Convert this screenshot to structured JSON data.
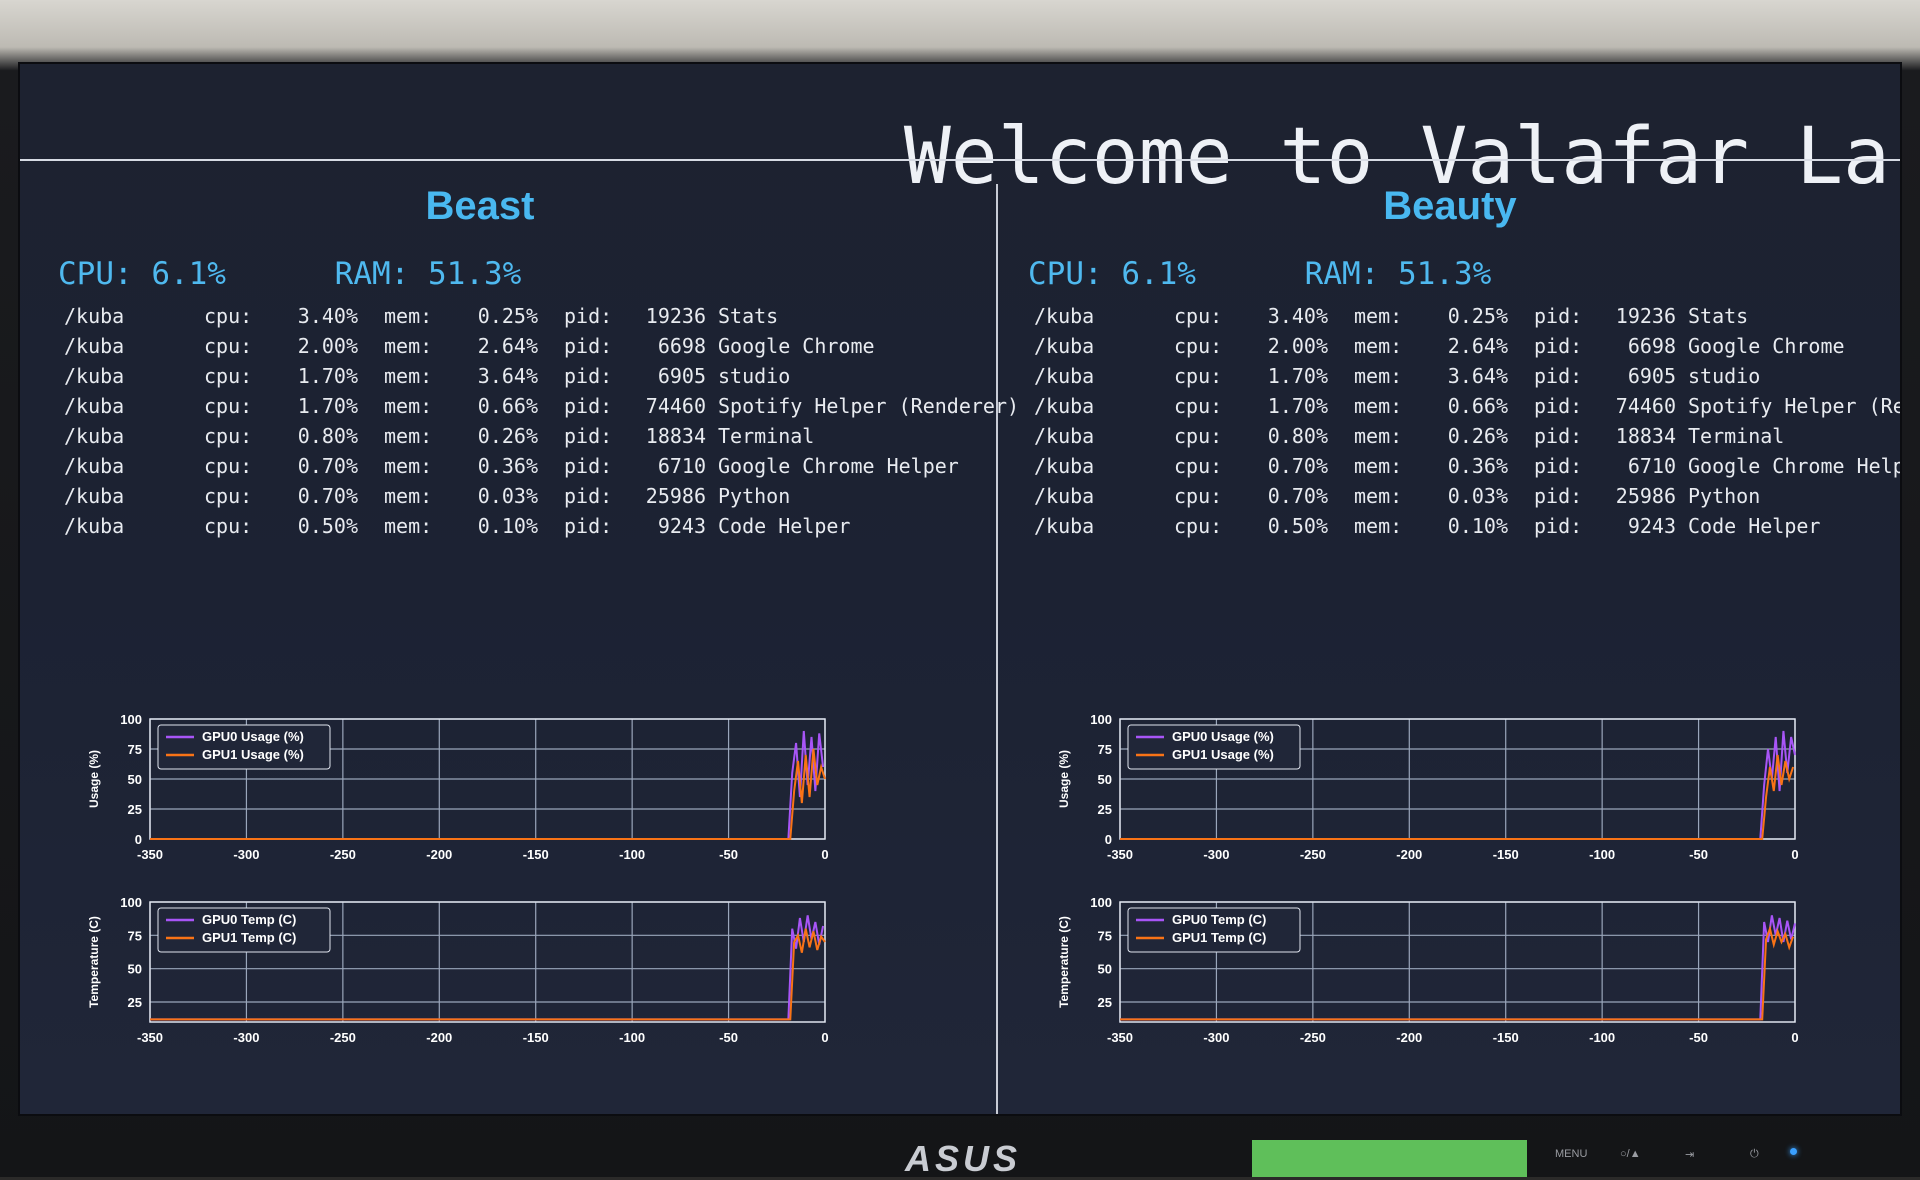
{
  "window_title": "Welcome to Valafar La",
  "panels": [
    {
      "title": "Beast",
      "cpu": "CPU: 6.1%",
      "ram": "RAM: 51.3%",
      "processes": [
        {
          "user": "/kuba",
          "cpu": "3.40%",
          "mem": "0.25%",
          "pid": "19236",
          "name": "Stats"
        },
        {
          "user": "/kuba",
          "cpu": "2.00%",
          "mem": "2.64%",
          "pid": "6698",
          "name": "Google Chrome"
        },
        {
          "user": "/kuba",
          "cpu": "1.70%",
          "mem": "3.64%",
          "pid": "6905",
          "name": "studio"
        },
        {
          "user": "/kuba",
          "cpu": "1.70%",
          "mem": "0.66%",
          "pid": "74460",
          "name": "Spotify Helper (Renderer)"
        },
        {
          "user": "/kuba",
          "cpu": "0.80%",
          "mem": "0.26%",
          "pid": "18834",
          "name": "Terminal"
        },
        {
          "user": "/kuba",
          "cpu": "0.70%",
          "mem": "0.36%",
          "pid": "6710",
          "name": "Google Chrome Helper"
        },
        {
          "user": "/kuba",
          "cpu": "0.70%",
          "mem": "0.03%",
          "pid": "25986",
          "name": "Python"
        },
        {
          "user": "/kuba",
          "cpu": "0.50%",
          "mem": "0.10%",
          "pid": "9243",
          "name": "Code Helper"
        }
      ]
    },
    {
      "title": "Beauty",
      "cpu": "CPU: 6.1%",
      "ram": "RAM: 51.3%",
      "processes": [
        {
          "user": "/kuba",
          "cpu": "3.40%",
          "mem": "0.25%",
          "pid": "19236",
          "name": "Stats"
        },
        {
          "user": "/kuba",
          "cpu": "2.00%",
          "mem": "2.64%",
          "pid": "6698",
          "name": "Google Chrome"
        },
        {
          "user": "/kuba",
          "cpu": "1.70%",
          "mem": "3.64%",
          "pid": "6905",
          "name": "studio"
        },
        {
          "user": "/kuba",
          "cpu": "1.70%",
          "mem": "0.66%",
          "pid": "74460",
          "name": "Spotify Helper (Renderer)"
        },
        {
          "user": "/kuba",
          "cpu": "0.80%",
          "mem": "0.26%",
          "pid": "18834",
          "name": "Terminal"
        },
        {
          "user": "/kuba",
          "cpu": "0.70%",
          "mem": "0.36%",
          "pid": "6710",
          "name": "Google Chrome Helper"
        },
        {
          "user": "/kuba",
          "cpu": "0.70%",
          "mem": "0.03%",
          "pid": "25986",
          "name": "Python"
        },
        {
          "user": "/kuba",
          "cpu": "0.50%",
          "mem": "0.10%",
          "pid": "9243",
          "name": "Code Helper"
        }
      ]
    }
  ],
  "labels": {
    "cpu": "cpu:",
    "mem": "mem:",
    "pid": "pid:"
  },
  "colors": {
    "gpu0": "#a855f7",
    "gpu1": "#f97316",
    "accent": "#49b8f0"
  },
  "chart_data": [
    {
      "type": "line",
      "panel": "Beast",
      "ylabel": "Usage (%)",
      "xlim": [
        -350,
        0
      ],
      "ylim": [
        0,
        100
      ],
      "xticks": [
        -350,
        -300,
        -250,
        -200,
        -150,
        -100,
        -50,
        0
      ],
      "yticks": [
        0,
        25,
        50,
        75,
        100
      ],
      "grid": true,
      "legend": "top-left",
      "series": [
        {
          "name": "GPU0 Usage (%)",
          "x": [
            -350,
            -19,
            -17,
            -15,
            -13,
            -11,
            -9,
            -7,
            -5,
            -3,
            -1
          ],
          "y": [
            0,
            0,
            55,
            80,
            35,
            90,
            45,
            85,
            40,
            88,
            60
          ]
        },
        {
          "name": "GPU1 Usage (%)",
          "x": [
            -350,
            -18,
            -16,
            -14,
            -12,
            -10,
            -8,
            -6,
            -4,
            -2,
            0
          ],
          "y": [
            0,
            0,
            40,
            65,
            30,
            70,
            35,
            75,
            45,
            60,
            50
          ]
        }
      ]
    },
    {
      "type": "line",
      "panel": "Beast",
      "ylabel": "Temperature (C)",
      "xlim": [
        -350,
        0
      ],
      "ylim": [
        10,
        100
      ],
      "xticks": [
        -350,
        -300,
        -250,
        -200,
        -150,
        -100,
        -50,
        0
      ],
      "yticks": [
        25,
        50,
        75,
        100
      ],
      "grid": true,
      "legend": "top-left",
      "series": [
        {
          "name": "GPU0 Temp (C)",
          "x": [
            -350,
            -19,
            -17,
            -15,
            -13,
            -11,
            -9,
            -7,
            -5,
            -3,
            -1
          ],
          "y": [
            12,
            12,
            80,
            65,
            88,
            70,
            90,
            72,
            85,
            68,
            82
          ]
        },
        {
          "name": "GPU1 Temp (C)",
          "x": [
            -350,
            -18,
            -16,
            -14,
            -12,
            -10,
            -8,
            -6,
            -4,
            -2,
            0
          ],
          "y": [
            12,
            12,
            70,
            75,
            62,
            80,
            66,
            78,
            64,
            74,
            70
          ]
        }
      ]
    },
    {
      "type": "line",
      "panel": "Beauty",
      "ylabel": "Usage (%)",
      "xlim": [
        -350,
        0
      ],
      "ylim": [
        0,
        100
      ],
      "xticks": [
        -350,
        -300,
        -250,
        -200,
        -150,
        -100,
        -50,
        0
      ],
      "yticks": [
        0,
        25,
        50,
        75,
        100
      ],
      "grid": true,
      "legend": "top-left",
      "series": [
        {
          "name": "GPU0 Usage (%)",
          "x": [
            -350,
            -18,
            -16,
            -14,
            -12,
            -10,
            -8,
            -6,
            -4,
            -2,
            0
          ],
          "y": [
            0,
            0,
            45,
            75,
            50,
            85,
            40,
            90,
            55,
            85,
            70
          ]
        },
        {
          "name": "GPU1 Usage (%)",
          "x": [
            -350,
            -17,
            -15,
            -13,
            -11,
            -9,
            -7,
            -5,
            -3,
            -1
          ],
          "y": [
            0,
            0,
            35,
            60,
            40,
            70,
            45,
            65,
            50,
            60
          ]
        }
      ]
    },
    {
      "type": "line",
      "panel": "Beauty",
      "ylabel": "Temperature (C)",
      "xlim": [
        -350,
        0
      ],
      "ylim": [
        10,
        100
      ],
      "xticks": [
        -350,
        -300,
        -250,
        -200,
        -150,
        -100,
        -50,
        0
      ],
      "yticks": [
        25,
        50,
        75,
        100
      ],
      "grid": true,
      "legend": "top-left",
      "series": [
        {
          "name": "GPU0 Temp (C)",
          "x": [
            -350,
            -18,
            -16,
            -14,
            -12,
            -10,
            -8,
            -6,
            -4,
            -2,
            0
          ],
          "y": [
            12,
            12,
            85,
            70,
            90,
            75,
            88,
            70,
            86,
            72,
            84
          ]
        },
        {
          "name": "GPU1 Temp (C)",
          "x": [
            -350,
            -17,
            -15,
            -13,
            -11,
            -9,
            -7,
            -5,
            -3,
            -1
          ],
          "y": [
            12,
            12,
            72,
            80,
            68,
            78,
            70,
            76,
            66,
            74
          ]
        }
      ]
    }
  ],
  "monitor": {
    "brand": "ASUS",
    "menu_label": "MENU",
    "button_2": "○/▲",
    "button_3": "⇥",
    "power_icon": "⏻"
  }
}
